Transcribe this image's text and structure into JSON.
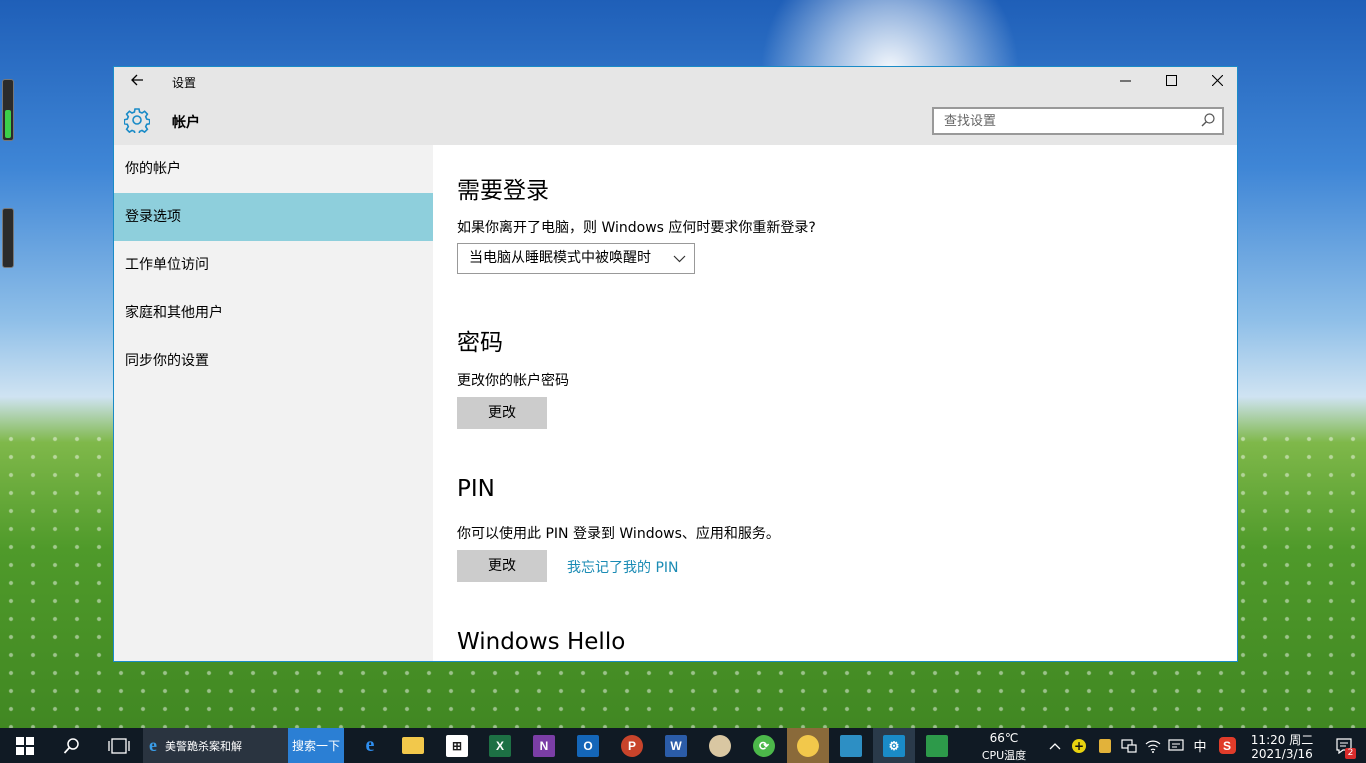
{
  "window": {
    "title": "设置",
    "header_title": "帐户",
    "search_placeholder": "查找设置"
  },
  "sidebar": {
    "items": [
      {
        "label": "你的帐户"
      },
      {
        "label": "登录选项",
        "active": true
      },
      {
        "label": "工作单位访问"
      },
      {
        "label": "家庭和其他用户"
      },
      {
        "label": "同步你的设置"
      }
    ]
  },
  "main": {
    "signin": {
      "heading": "需要登录",
      "description": "如果你离开了电脑，则 Windows 应何时要求你重新登录?",
      "dropdown_value": "当电脑从睡眠模式中被唤醒时"
    },
    "password": {
      "heading": "密码",
      "description": "更改你的帐户密码",
      "button": "更改"
    },
    "pin": {
      "heading": "PIN",
      "description": "你可以使用此 PIN 登录到 Windows、应用和服务。",
      "button": "更改",
      "link": "我忘记了我的 PIN"
    },
    "hello": {
      "heading": "Windows Hello"
    }
  },
  "taskbar": {
    "ie_tab_label": "美警跪杀案和解",
    "search_button": "搜索一下",
    "temperature": "66℃",
    "temperature_label": "CPU温度",
    "ime": "中",
    "time": "11:20 周二",
    "date": "2021/3/16",
    "notification_count": "2",
    "apps": [
      "edge-icon",
      "file-explorer-icon",
      "store-icon",
      "excel-icon",
      "onenote-icon",
      "outlook-icon",
      "powerpoint-icon",
      "word-icon",
      "paint-icon",
      "green-app-icon",
      "pencil-app-icon",
      "photo-app-icon",
      "settings-icon",
      "green-book-icon"
    ]
  },
  "colors": {
    "accent": "#1a8bc7",
    "active_nav": "#8ecfdc",
    "link": "#1a8bb4"
  }
}
